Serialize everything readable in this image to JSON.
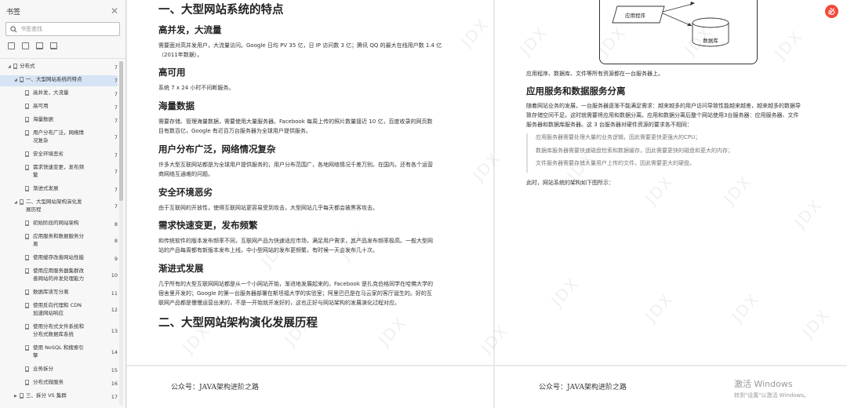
{
  "sidebar": {
    "title": "书签",
    "search_placeholder": "书签查找",
    "toc": [
      {
        "label": "分布式",
        "page": "7"
      },
      {
        "label": "一、大型网站系统的特点",
        "page": "7"
      },
      {
        "label": "高并发，大流量",
        "page": "7"
      },
      {
        "label": "高可用",
        "page": "7"
      },
      {
        "label": "海量数据",
        "page": "7"
      },
      {
        "label": "用户分布广泛，网络情",
        "label2": "况复杂",
        "page": "7"
      },
      {
        "label": "安全环境恶劣",
        "page": "7"
      },
      {
        "label": "需求快速变更，发布频",
        "label2": "繁",
        "page": "7"
      },
      {
        "label": "渐进式发展",
        "page": "7"
      },
      {
        "label": "二、大型网站架构演化发",
        "label2": "展历程",
        "page": "7"
      },
      {
        "label": "初始阶段的网站架构",
        "page": "8"
      },
      {
        "label": "应用服务和数据服务分",
        "label2": "离",
        "page": "8"
      },
      {
        "label": "使用缓存改善网站性能",
        "page": "9"
      },
      {
        "label": "使用应用服务器集群改",
        "label2": "善网站的并发处理能力",
        "page": "10"
      },
      {
        "label": "数据库读写分离",
        "page": "11"
      },
      {
        "label": "使用反向代理和 CDN",
        "label2": "加速网站响应",
        "page": "12"
      },
      {
        "label": "使用分布式文件系统和",
        "label2": "分布式数据库系统",
        "page": "13"
      },
      {
        "label": "使用 NoSQL 和搜索引",
        "label2": "擎",
        "page": "14"
      },
      {
        "label": "业务拆分",
        "page": "15"
      },
      {
        "label": "分布式微服务",
        "page": "16"
      },
      {
        "label": "三、拆分 VS 集群",
        "page": "17"
      }
    ]
  },
  "left_page": {
    "title": "一、大型网站系统的特点",
    "sections": [
      {
        "heading": "高并发，大流量",
        "lines": [
          "需要面对高并发用户，大流量访问。Google 日均 PV 35 亿，日 IP 访问数 3 亿；腾讯 QQ 的最大在线用户数 1.4 亿",
          "（2011年数据）。"
        ]
      },
      {
        "heading": "高可用",
        "lines": [
          "系统 7 x 24 小时不间断服务。"
        ]
      },
      {
        "heading": "海量数据",
        "lines": [
          "需要存储、管理海量数据，需要使用大量服务器。Facebook 每周上传的照片数量接近 10 亿，百度收录的网页数",
          "目有数百亿，Google 有近百万台服务器为全球用户提供服务。"
        ]
      },
      {
        "heading": "用户分布广泛，网络情况复杂",
        "lines": [
          "许多大型互联网站都是为全球用户提供服务的，用户分布范围广，各地网络情况千差万别。在国内，还有各个运营",
          "商网络互通难的问题。"
        ]
      },
      {
        "heading": "安全环境恶劣",
        "lines": [
          "由于互联网的开放性，使得互联网站更容易受到攻击，大型网站几乎每天都会被黑客攻击。"
        ]
      },
      {
        "heading": "需求快速变更，发布频繁",
        "lines": [
          "和传统软件的版本发布频率不同，互联网产品为快速适应市场，满足用户需求，其产品发布频率极高。一般大型网",
          "站的产品每周都有新版本发布上线，中小型网站的发布更频繁，有时候一天会发布几十次。"
        ]
      },
      {
        "heading": "渐进式发展",
        "lines": [
          "几乎所有的大型互联网网站都是从一个小网站开始，渐进地发展起来的。Facebook 是扎克伯格同学在哈佛大学的",
          "宿舍里开发的；Google 的第一台服务器部署在斯坦福大学的实验室；阿里巴巴是在马云家的客厅诞生的。好的互",
          "联网产品都是慢慢运营出来的，不是一开始就开发好的，这也正好与网站架构的发展演化过程对应。"
        ]
      }
    ],
    "title2": "二、大型网站架构演化发展历程",
    "footer": "公众号：JAVA架构进阶之路"
  },
  "right_page": {
    "diagram": {
      "app_label": "应用程序",
      "db_label": "数据库"
    },
    "caption": "应用程序、数据库、文件等所有资源都在一台服务器上。",
    "heading": "应用服务和数据服务分离",
    "para": [
      "随着网站业务的发展，一台服务器逐渐不能满足需求：越来越多的用户访问导致性能越来越差，越来越多的数据导",
      "致存储空间不足。这时就需要将应用和数据分离。应用和数据分离后整个网站使用3台服务器：应用服务器、文件",
      "服务器和数据库服务器。这 3 台服务器对硬件资源的要求各不相同："
    ],
    "quotes": [
      "应用服务器需要处理大量的业务逻辑，因此需要更快更强大的CPU；",
      "数据库服务器需要快速磁盘检索和数据缓存，因此需要更快的磁盘和更大的内存；",
      "文件服务器需要存储大量用户上传的文件，因此需要更大的硬盘。"
    ],
    "after": "此时，网站系统的架构如下图所示：",
    "footer": "公众号：JAVA架构进阶之路"
  },
  "watermark": "JDX",
  "badge": "必",
  "activation": {
    "line1": "激活 Windows",
    "line2": "转到\"设置\"以激活 Windows。"
  }
}
